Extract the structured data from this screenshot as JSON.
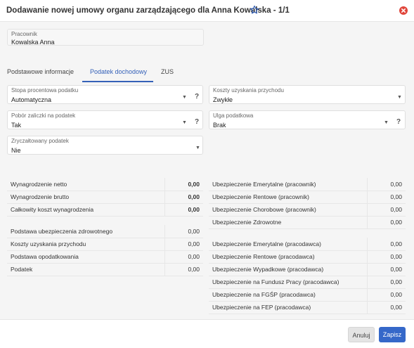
{
  "dialog": {
    "title": "Dodawanie nowej umowy organu zarządzającego dla Anna Kowalska - 1/1"
  },
  "employee": {
    "label": "Pracownik",
    "value": "Kowalska Anna"
  },
  "tabs": [
    {
      "label": "Podstawowe informacje",
      "active": false
    },
    {
      "label": "Podatek dochodowy",
      "active": true
    },
    {
      "label": "ZUS",
      "active": false
    }
  ],
  "form": {
    "tax_rate": {
      "label": "Stopa procentowa podatku",
      "value": "Automatyczna"
    },
    "costs": {
      "label": "Koszty uzyskania przychodu",
      "value": "Zwykłe"
    },
    "advance": {
      "label": "Pobór zaliczki na podatek",
      "value": "Tak"
    },
    "relief": {
      "label": "Ulga podatkowa",
      "value": "Brak"
    },
    "flat_tax": {
      "label": "Zryczałtowany podatek",
      "value": "Nie"
    },
    "help_symbol": "?"
  },
  "left_summary_1": [
    {
      "label": "Wynagrodzenie netto",
      "value": "0,00"
    },
    {
      "label": "Wynagrodzenie brutto",
      "value": "0,00"
    },
    {
      "label": "Całkowity koszt wynagrodzenia",
      "value": "0,00"
    }
  ],
  "left_summary_2": [
    {
      "label": "Podstawa ubezpieczenia zdrowotnego",
      "value": "0,00"
    },
    {
      "label": "Koszty uzyskania przychodu",
      "value": "0,00"
    },
    {
      "label": "Podstawa opodatkowania",
      "value": "0,00"
    },
    {
      "label": "Podatek",
      "value": "0,00"
    }
  ],
  "right_summary_1": [
    {
      "label": "Ubezpieczenie Emerytalne (pracownik)",
      "value": "0,00"
    },
    {
      "label": "Ubezpieczenie Rentowe (pracownik)",
      "value": "0,00"
    },
    {
      "label": "Ubezpieczenie Chorobowe (pracownik)",
      "value": "0,00"
    },
    {
      "label": "Ubezpieczenie Zdrowotne",
      "value": "0,00"
    }
  ],
  "right_summary_2": [
    {
      "label": "Ubezpieczenie Emerytalne (pracodawca)",
      "value": "0,00"
    },
    {
      "label": "Ubezpieczenie Rentowe (pracodawca)",
      "value": "0,00"
    },
    {
      "label": "Ubezpieczenie Wypadkowe (pracodawca)",
      "value": "0,00"
    },
    {
      "label": "Ubezpieczenie na Fundusz Pracy (pracodawca)",
      "value": "0,00"
    },
    {
      "label": "Ubezpieczenie na FGŚP (pracodawca)",
      "value": "0,00"
    },
    {
      "label": "Ubezpieczenie na FEP (pracodawca)",
      "value": "0,00"
    }
  ],
  "footer": {
    "cancel_label": "Anuluj",
    "save_label": "Zapisz"
  },
  "colors": {
    "accent": "#3561b8",
    "save_button": "#3568c9",
    "close_icon": "#e0463b",
    "star_icon": "#3561b8"
  },
  "icons": {
    "favorite": "star-icon",
    "close": "close-icon",
    "dropdown": "chevron-down-icon"
  }
}
